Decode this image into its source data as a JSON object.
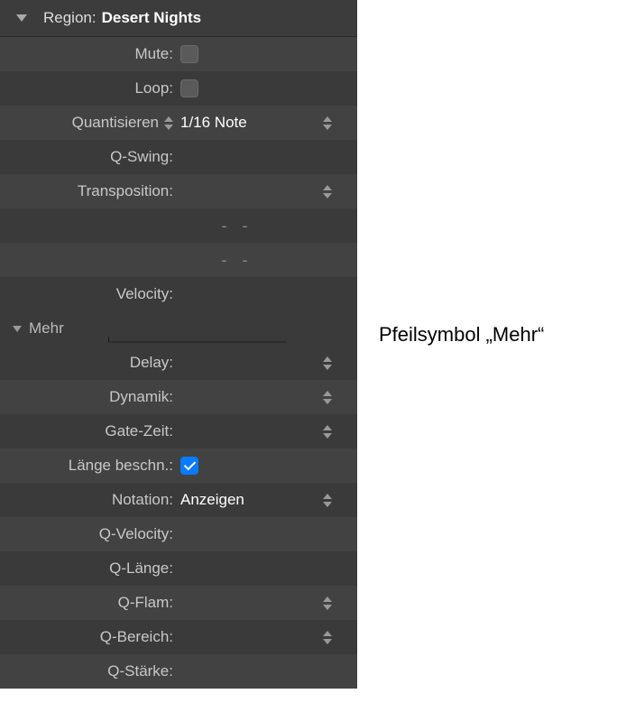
{
  "header": {
    "label": "Region:",
    "value": "Desert Nights"
  },
  "rows": {
    "mute": "Mute:",
    "loop": "Loop:",
    "quantize_label": "Quantisieren",
    "quantize_value": "1/16 Note",
    "qswing": "Q-Swing:",
    "transposition": "Transposition:",
    "dash": "-  -",
    "velocity": "Velocity:",
    "mehr": "Mehr",
    "delay": "Delay:",
    "dynamik": "Dynamik:",
    "gatezeit": "Gate-Zeit:",
    "laenge": "Länge beschn.:",
    "notation_label": "Notation:",
    "notation_value": "Anzeigen",
    "qvelocity": "Q-Velocity:",
    "qlaenge": "Q-Länge:",
    "qflam": "Q-Flam:",
    "qbereich": "Q-Bereich:",
    "qstaerke": "Q-Stärke:"
  },
  "annotation": "Pfeilsymbol „Mehr“"
}
